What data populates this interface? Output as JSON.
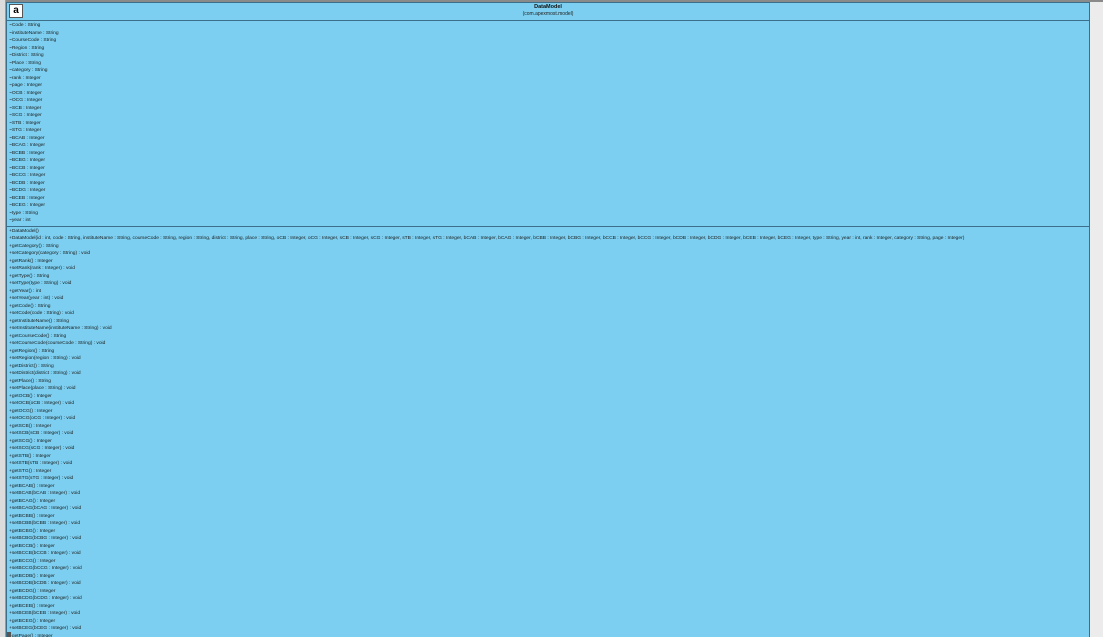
{
  "class": {
    "badge": "a",
    "name": "DataModel",
    "package": "(com.apexmost.model)",
    "attributes": [
      "~Code : String",
      "~instituteName : String",
      "~CourseCode : String",
      "~Region : String",
      "~District : String",
      "~Place : String",
      "~category : String",
      "~rank : Integer",
      "~page : Integer",
      "~OCB : Integer",
      "~OCG : Integer",
      "~SCB : Integer",
      "~SCG : Integer",
      "~STB : Integer",
      "~STG : Integer",
      "~BCAB : Integer",
      "~BCAG : Integer",
      "~BCBB : Integer",
      "~BCBG : Integer",
      "~BCCB : Integer",
      "~BCCG : Integer",
      "~BCDB : Integer",
      "~BCDG : Integer",
      "~BCEB : Integer",
      "~BCEG : Integer",
      "~type : String",
      "~year : int"
    ],
    "operations": [
      "+DataModel()",
      "+DataModel(id : int, code : String, instituteName : String, courseCode : String, region : String, district : String, place : String, oCB : Integer, oCG : Integer, sCB : Integer, sCG : Integer, sTB : Integer, sTG : Integer, bCAB : Integer, bCAG : Integer, bCBB : Integer, bCBG : Integer, bCCB : Integer, bCCG : Integer, bCDB : Integer, bCDG : Integer, bCEB : Integer, bCEG : Integer, type : String, year : int, rank : Integer, category : String, page : Integer)",
      "+getCategory() : String",
      "+setCategory(category : String) : void",
      "+getRank() : Integer",
      "+setRank(rank : Integer) : void",
      "+getType() : String",
      "+setType(type : String) : void",
      "+getYear() : int",
      "+setYear(year : int) : void",
      "+getCode() : String",
      "+setCode(code : String) : void",
      "+getInstituteName() : String",
      "+setInstituteName(instituteName : String) : void",
      "+getCourseCode() : String",
      "+setCourseCode(courseCode : String) : void",
      "+getRegion() : String",
      "+setRegion(region : String) : void",
      "+getDistrict() : String",
      "+setDistrict(district : String) : void",
      "+getPlace() : String",
      "+setPlace(place : String) : void",
      "+getOCB() : Integer",
      "+setOCB(oCB : Integer) : void",
      "+getOCG() : Integer",
      "+setOCG(oCG : Integer) : void",
      "+getSCB() : Integer",
      "+setSCB(sCB : Integer) : void",
      "+getSCG() : Integer",
      "+setSCG(sCG : Integer) : void",
      "+getSTB() : Integer",
      "+setSTB(sTB : Integer) : void",
      "+getSTG() : Integer",
      "+setSTG(sTG : Integer) : void",
      "+getBCAB() : Integer",
      "+setBCAB(bCAB : Integer) : void",
      "+getBCAG() : Integer",
      "+setBCAG(bCAG : Integer) : void",
      "+getBCBB() : Integer",
      "+setBCBB(bCBB : Integer) : void",
      "+getBCBG() : Integer",
      "+setBCBG(bCBG : Integer) : void",
      "+getBCCB() : Integer",
      "+setBCCB(bCCB : Integer) : void",
      "+getBCCG() : Integer",
      "+setBCCG(bCCG : Integer) : void",
      "+getBCDB() : Integer",
      "+setBCDB(bCDB : Integer) : void",
      "+getBCDG() : Integer",
      "+setBCDG(bCDG : Integer) : void",
      "+getBCEB() : Integer",
      "+setBCEB(bCEB : Integer) : void",
      "+getBCEG() : Integer",
      "+setBCEG(bCEG : Integer) : void",
      "+getPage() : Integer"
    ]
  },
  "colors": {
    "class_fill": "#7ccff0",
    "class_border": "#3c6f8a",
    "canvas": "#ececec"
  }
}
